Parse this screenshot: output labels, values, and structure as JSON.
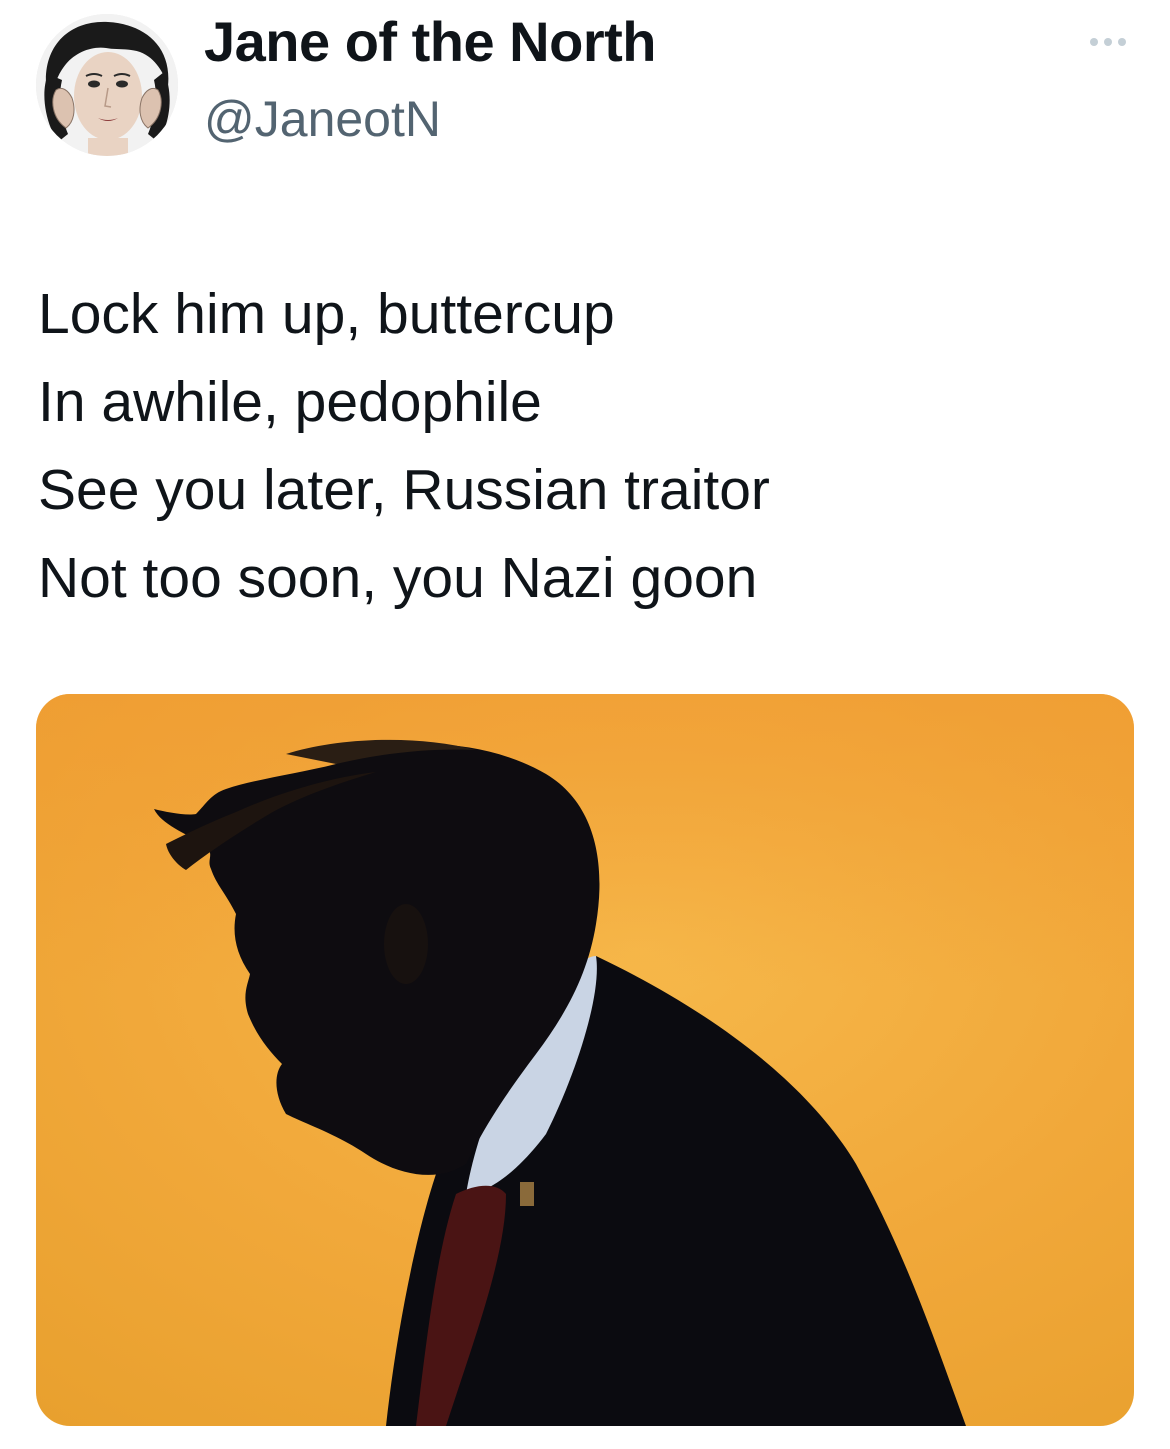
{
  "tweet": {
    "author": {
      "display_name": "Jane of the North",
      "handle": "@JaneotN",
      "avatar_icon": "avatar-photo"
    },
    "more_icon": "more-dots-icon",
    "text_lines": [
      "Lock him up, buttercup",
      "In awhile, pedophile",
      "See you later, Russian traitor",
      "Not too soon, you Nazi goon"
    ],
    "media": {
      "kind": "photo",
      "icon": "silhouette-photo"
    }
  },
  "colors": {
    "text_primary": "#0f1419",
    "text_secondary": "#536471",
    "media_background": "#f0a43a"
  }
}
